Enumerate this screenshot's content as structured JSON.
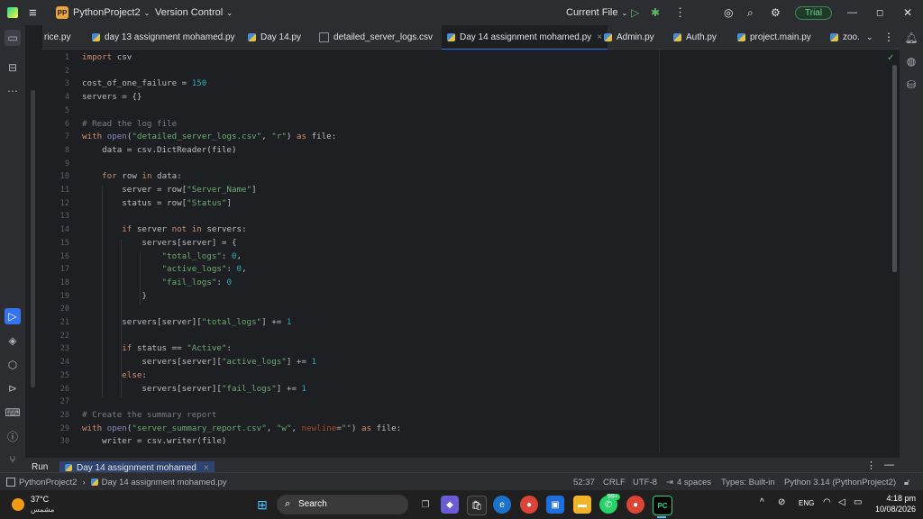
{
  "titlebar": {
    "project_badge": "PP",
    "project_name": "PythonProject2",
    "vcs": "Version Control",
    "run_config": "Current File",
    "trial": "Trial"
  },
  "tabs": [
    {
      "label": "rice.py",
      "active": false
    },
    {
      "label": "day 13 assignment mohamed.py",
      "active": false
    },
    {
      "label": "Day 14.py",
      "active": false
    },
    {
      "label": "detailed_server_logs.csv",
      "active": false
    },
    {
      "label": "Day 14 assignment mohamed.py",
      "active": true
    },
    {
      "label": "Admin.py",
      "active": false
    },
    {
      "label": "Auth.py",
      "active": false
    },
    {
      "label": "project.main.py",
      "active": false
    },
    {
      "label": "zoo.",
      "active": false
    }
  ],
  "code_lines": [
    {
      "n": "1",
      "html": "<span class='kw'>import</span> csv"
    },
    {
      "n": "2",
      "html": ""
    },
    {
      "n": "3",
      "html": "cost_of_one_failure = <span class='num'>150</span>"
    },
    {
      "n": "4",
      "html": "servers = {}"
    },
    {
      "n": "5",
      "html": ""
    },
    {
      "n": "6",
      "html": "<span class='cm'># Read the log file</span>"
    },
    {
      "n": "7",
      "html": "<span class='kw'>with</span> <span class='bi'>open</span>(<span class='str'>\"detailed_server_logs.csv\"</span>, <span class='str'>\"r\"</span>) <span class='kw'>as</span> file:"
    },
    {
      "n": "8",
      "html": "    data = csv.DictReader(file)"
    },
    {
      "n": "9",
      "html": ""
    },
    {
      "n": "10",
      "html": "    <span class='kw'>for</span> row <span class='kw'>in</span> data:"
    },
    {
      "n": "11",
      "html": "        server = row[<span class='str'>\"Server_Name\"</span>]"
    },
    {
      "n": "12",
      "html": "        status = row[<span class='str'>\"Status\"</span>]"
    },
    {
      "n": "13",
      "html": ""
    },
    {
      "n": "14",
      "html": "        <span class='kw'>if</span> server <span class='kw'>not in</span> servers:"
    },
    {
      "n": "15",
      "html": "            servers[server] = {"
    },
    {
      "n": "16",
      "html": "                <span class='str'>\"total_logs\"</span>: <span class='num'>0</span>,"
    },
    {
      "n": "17",
      "html": "                <span class='str'>\"active_logs\"</span>: <span class='num'>0</span>,"
    },
    {
      "n": "18",
      "html": "                <span class='str'>\"fail_logs\"</span>: <span class='num'>0</span>"
    },
    {
      "n": "19",
      "html": "            }"
    },
    {
      "n": "20",
      "html": ""
    },
    {
      "n": "21",
      "html": "        servers[server][<span class='str'>\"total_logs\"</span>] += <span class='num'>1</span>"
    },
    {
      "n": "22",
      "html": ""
    },
    {
      "n": "23",
      "html": "        <span class='kw'>if</span> status == <span class='str'>\"Active\"</span>:"
    },
    {
      "n": "24",
      "html": "            servers[server][<span class='str'>\"active_logs\"</span>] += <span class='num'>1</span>"
    },
    {
      "n": "25",
      "html": "        <span class='kw'>else</span>:"
    },
    {
      "n": "26",
      "html": "            servers[server][<span class='str'>\"fail_logs\"</span>] += <span class='num'>1</span>"
    },
    {
      "n": "27",
      "html": ""
    },
    {
      "n": "28",
      "html": "<span class='cm'># Create the summary report</span>"
    },
    {
      "n": "29",
      "html": "<span class='kw'>with</span> <span class='bi'>open</span>(<span class='str'>\"server_summary_report.csv\"</span>, <span class='str'>\"w\"</span>, <span class='pm'>newline</span>=<span class='str'>\"\"</span>) <span class='kw'>as</span> file:"
    },
    {
      "n": "30",
      "html": "    writer = csv.writer(file)"
    }
  ],
  "run": {
    "label": "Run",
    "tab": "Day 14 assignment mohamed"
  },
  "status": {
    "project": "PythonProject2",
    "file": "Day 14 assignment mohamed.py",
    "position": "52:37",
    "line_sep": "CRLF",
    "encoding": "UTF-8",
    "indent": "4 spaces",
    "types": "Types: Built-in",
    "interpreter": "Python 3.14 (PythonProject2)"
  },
  "taskbar": {
    "temp": "37°C",
    "weather": "مشمس",
    "search": "Search",
    "badge": "99+",
    "lang": "ENG",
    "time": "4:18 pm",
    "date": "10/08/2026"
  },
  "colors": {
    "accent": "#3574f0",
    "trial": "#6fd28f"
  }
}
